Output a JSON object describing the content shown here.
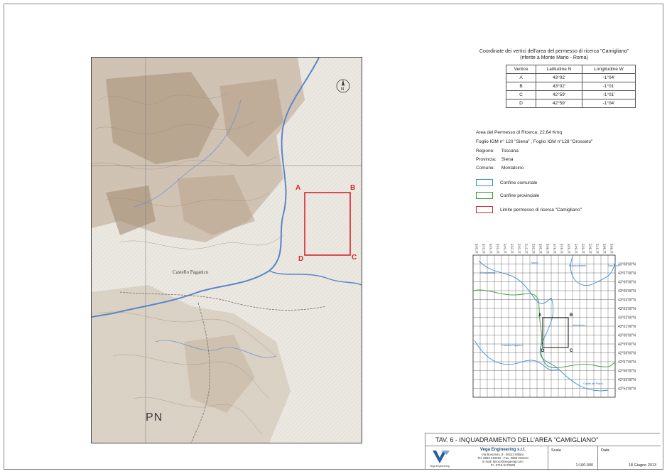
{
  "map_labels": {
    "point_a": "A",
    "point_b": "B",
    "point_c": "C",
    "point_d": "D",
    "pn": "PN",
    "north": "N",
    "town_1": "Castello Paganico"
  },
  "coordinates": {
    "title_line1": "Coordinate dei vertici dell'area del permesso di ricerca \"Camigliano\"",
    "title_line2": "(riferite a Monte Mario - Roma)",
    "headers": [
      "Vertice",
      "Latitudine N",
      "Longitudine W"
    ],
    "rows": [
      [
        "A",
        "43°02'",
        "-1°04'"
      ],
      [
        "B",
        "43°02'",
        "-1°01'"
      ],
      [
        "C",
        "42°59'",
        "-1°01'"
      ],
      [
        "D",
        "42°59'",
        "-1°04'"
      ]
    ]
  },
  "info": {
    "area": "Area del Permesso di Ricerca: 22,64 Kmq",
    "foglio": "Foglio IGM n° 120 \"Siena\"  , Foglio IGM n°128 \"Grosseto\"",
    "regione_label": "Regione:",
    "regione_value": "Toscana",
    "provincia_label": "Provincia:",
    "provincia_value": "Siena",
    "comune_label": "Comune:",
    "comune_value": "Montalcino"
  },
  "legend": [
    {
      "label": "Confine comunale",
      "color": "#3a8fd4"
    },
    {
      "label": "Confine provinciale",
      "color": "#3d9a36"
    },
    {
      "label": "Limite permesso di ricerca \"Camigliano\"",
      "color": "#d6262c"
    }
  ],
  "mini_map": {
    "lon_labels": [
      "11°20'E",
      "11°21'E",
      "11°22'E",
      "11°23'E",
      "11°24'E",
      "11°25'E",
      "11°26'E",
      "11°27'E",
      "11°28'E",
      "11°29'E",
      "11°30'E",
      "11°31'E",
      "11°32'E",
      "11°33'E",
      "11°34'E",
      "11°35'E",
      "11°36'E",
      "11°37'E",
      "11°38'E",
      "11°39'E"
    ],
    "lat_labels": [
      "43°08'00\"N",
      "43°07'00\"N",
      "43°06'00\"N",
      "43°05'00\"N",
      "43°04'00\"N",
      "43°03'00\"N",
      "43°02'00\"N",
      "43°01'00\"N",
      "43°00'00\"N",
      "42°59'00\"N",
      "42°58'00\"N",
      "42°57'00\"N",
      "42°56'00\"N",
      "42°55'00\"N",
      "42°54'00\"N"
    ],
    "vertex_a": "A",
    "vertex_b": "B",
    "vertex_c": "C",
    "vertex_d": "D",
    "place_1": "Murlo",
    "place_2": "Buonconvento",
    "place_3": "San Giov.",
    "place_4": "Roccastrada",
    "place_5": "Montalcino",
    "place_6": "Civitella Paganico",
    "place_7": "Castel del Piano"
  },
  "title_block": {
    "title": "TAV. 6 - INQUADRAMENTO DELL'AREA \"CAMIGLIANO\"",
    "company_name": "Vega Engineering s.r.l.",
    "company_line1": "Via Bonomini, 8 - 36123 Milano",
    "company_line2": "Tel. 0983 010010 - Fax. 0983 010210",
    "company_line3": "E-mail: lavoro@vegaengl.com",
    "company_line4": "P.I. 0715 9175905",
    "logo_caption": "Vega Engineering",
    "scale_label": "Scala",
    "scale_value": "1:100.000",
    "date_label": "Data",
    "date_value": "18 Giugno 2013"
  },
  "colors": {
    "permit": "#d6262c",
    "comunale": "#3a8fd4",
    "provinciale": "#3d9a36",
    "terrain": "#b9a58f",
    "water": "#5b86c8",
    "logo": "#2a5d9f"
  }
}
